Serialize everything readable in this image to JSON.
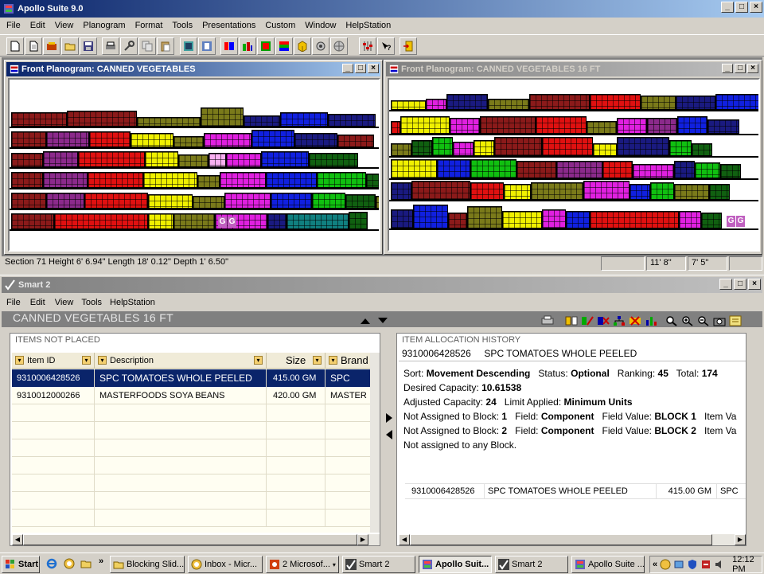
{
  "app": {
    "title": "Apollo Suite 9.0",
    "menu": [
      "File",
      "Edit",
      "View",
      "Planogram",
      "Format",
      "Tools",
      "Presentations",
      "Custom",
      "Window",
      "HelpStation"
    ]
  },
  "planogram_left": {
    "title": "Front Planogram: CANNED VEGETABLES",
    "labels": [
      "G",
      "G"
    ]
  },
  "planogram_right": {
    "title": "Front Planogram: CANNED VEGETABLES 16 FT",
    "labels": [
      "G",
      "G"
    ]
  },
  "statusbar": {
    "section": "Section 71  Height 6' 6.94\"  Length 18' 0.12\"  Depth 1' 6.50\"",
    "coord_x": "11' 8\"",
    "coord_y": "7' 5\""
  },
  "smart": {
    "title": "Smart 2",
    "menu": [
      "File",
      "Edit",
      "View",
      "Tools",
      "HelpStation"
    ],
    "heading": "CANNED VEGETABLES 16 FT",
    "items_not_placed": {
      "title": "ITEMS NOT PLACED",
      "columns": [
        "Item ID",
        "Description",
        "Size",
        "Brand"
      ],
      "rows": [
        {
          "id": "9310006428526",
          "desc": "SPC TOMATOES WHOLE PEELED",
          "size": "415.00 GM",
          "brand": "SPC"
        },
        {
          "id": "9310012000266",
          "desc": "MASTERFOODS SOYA BEANS",
          "size": "420.00 GM",
          "brand": "MASTER"
        }
      ]
    },
    "history": {
      "title": "ITEM ALLOCATION HISTORY",
      "item_header": "9310006428526     SPC TOMATOES WHOLE PEELED",
      "sort_label": "Sort:",
      "sort_value": "Movement Descending",
      "status_label": "Status:",
      "status_value": "Optional",
      "ranking_label": "Ranking:",
      "ranking_value": "45",
      "total_label": "Total:",
      "total_value": "174",
      "desired_label": "Desired Capacity:",
      "desired_value": "10.61538",
      "adjusted_label": "Adjusted Capacity:",
      "adjusted_value": "24",
      "limit_label": "Limit Applied:",
      "limit_value": "Minimum Units",
      "na1_label": "Not Assigned to Block:",
      "na1_num": "1",
      "na1_field_label": "Field:",
      "na1_field": "Component",
      "na1_value_label": "Field Value:",
      "na1_value": "BLOCK 1",
      "na1_more": "Item Va",
      "na2_label": "Not Assigned to Block:",
      "na2_num": "2",
      "na2_field_label": "Field:",
      "na2_field": "Component",
      "na2_value_label": "Field Value:",
      "na2_value": "BLOCK 2",
      "na2_more": "Item Va",
      "not_any": "Not assigned to any Block.",
      "footer": {
        "id": "9310006428526",
        "desc": "SPC TOMATOES WHOLE PEELED",
        "size": "415.00 GM",
        "brand": "SPC"
      }
    }
  },
  "taskbar": {
    "start": "Start",
    "buttons": [
      "Blocking Slid...",
      "Inbox - Micr...",
      "2 Microsof...",
      "Smart 2",
      "Apollo Suit...",
      "Smart 2",
      "Apollo Suite ..."
    ],
    "clock": "12:12 PM"
  },
  "colors": {
    "title_active": "#0a246a",
    "selection": "#0a246a",
    "desktop": "#d4d0c8"
  }
}
